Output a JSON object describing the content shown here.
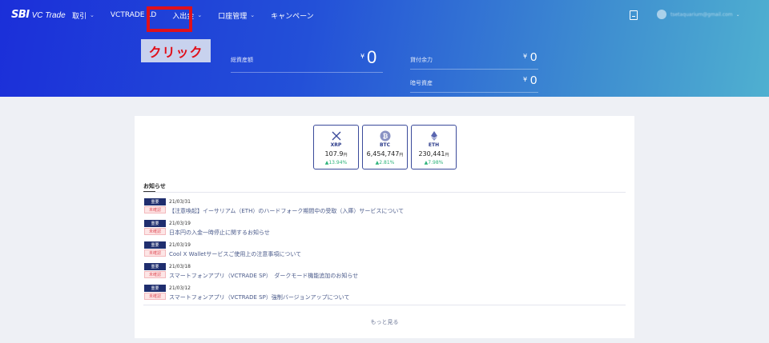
{
  "brand": {
    "sbi": "SBI",
    "vc": "VC Trade"
  },
  "nav": [
    {
      "label": "取引",
      "has_dropdown": true
    },
    {
      "label": "VCTRADE LD",
      "has_dropdown": false
    },
    {
      "label": "入出金",
      "has_dropdown": true
    },
    {
      "label": "口座管理",
      "has_dropdown": true
    },
    {
      "label": "キャンペーン",
      "has_dropdown": false
    }
  ],
  "annotation": {
    "label": "クリック",
    "color": "#e0101b"
  },
  "user": {
    "email": "tsetaquarium@gmail.com"
  },
  "summary": {
    "total_assets_label": "総資産額",
    "total_assets_value": "0",
    "lending_label": "貸付余力",
    "lending_value": "0",
    "crypto_label": "暗号資産",
    "crypto_value": "0",
    "currency_symbol": "¥"
  },
  "coins": [
    {
      "symbol": "XRP",
      "icon": "xrp-icon",
      "price": "107.9",
      "unit": "円",
      "change": "▲13.94%"
    },
    {
      "symbol": "BTC",
      "icon": "btc-icon",
      "price": "6,454,747",
      "unit": "円",
      "change": "▲2.81%"
    },
    {
      "symbol": "ETH",
      "icon": "eth-icon",
      "price": "230,441",
      "unit": "円",
      "change": "▲7.98%"
    }
  ],
  "news": {
    "heading": "お知らせ",
    "items": [
      {
        "badge_important": "重要",
        "badge_unconfirmed": "未確認",
        "date": "21/03/31",
        "title": "【注意喚起】イーサリアム（ETH）のハードフォーク期間中の受取（入庫）サービスについて"
      },
      {
        "badge_important": "重要",
        "badge_unconfirmed": "未確認",
        "date": "21/03/19",
        "title": "日本円の入金一時停止に関するお知らせ"
      },
      {
        "badge_important": "重要",
        "badge_unconfirmed": "未確認",
        "date": "21/03/19",
        "title": "Cool X Walletサービスご使用上の注意事項について"
      },
      {
        "badge_important": "重要",
        "badge_unconfirmed": "未確認",
        "date": "21/03/18",
        "title": "スマートフォンアプリ（VCTRADE SP）　ダークモード機能追加のお知らせ"
      },
      {
        "badge_important": "重要",
        "badge_unconfirmed": "未確認",
        "date": "21/03/12",
        "title": "スマートフォンアプリ（VCTRADE SP）強制バージョンアップについて"
      }
    ],
    "more": "もっと見る"
  },
  "colors": {
    "accent": "#1f2e6e",
    "positive": "#2db37a",
    "highlight": "#e0101b"
  }
}
